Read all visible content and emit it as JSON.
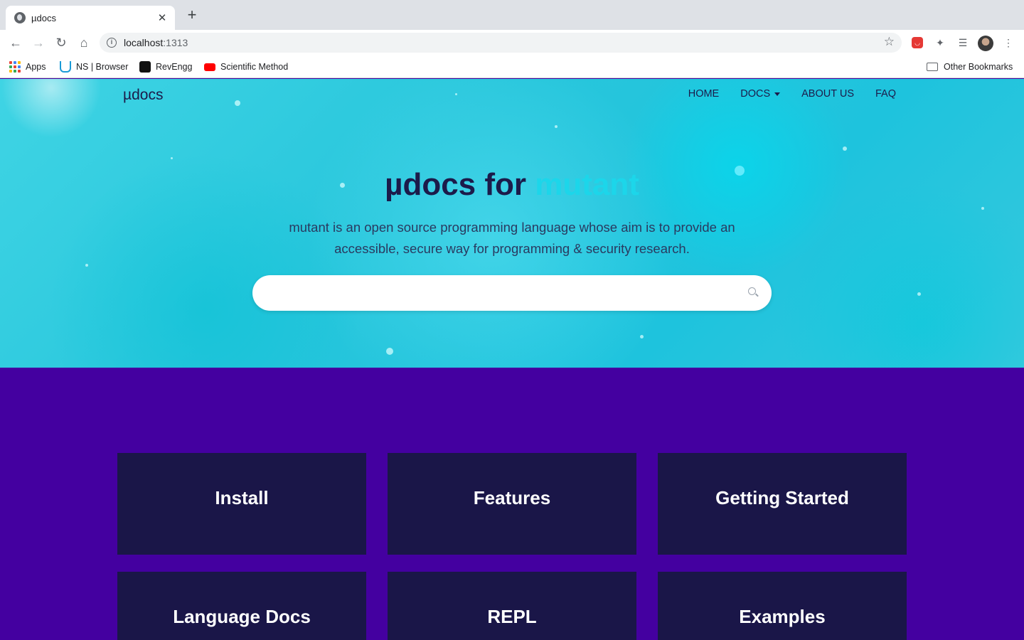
{
  "browser": {
    "tab_title": "µdocs",
    "tab_close": "✕",
    "new_tab": "+",
    "url_host": "localhost",
    "url_port": ":1313",
    "bookmarks": [
      {
        "label": "Apps"
      },
      {
        "label": "NS | Browser"
      },
      {
        "label": "RevEngg"
      },
      {
        "label": "Scientific Method"
      }
    ],
    "other_bookmarks": "Other Bookmarks"
  },
  "site": {
    "brand": "µdocs",
    "nav": [
      {
        "label": "HOME"
      },
      {
        "label": "DOCS"
      },
      {
        "label": "ABOUT US"
      },
      {
        "label": "FAQ"
      }
    ],
    "hero": {
      "title_main": "µdocs for ",
      "title_accent": "mutant",
      "subtitle": "mutant is an open source programming language whose aim is to provide an accessible, secure way for programming & security research.",
      "search_value": "",
      "search_placeholder": ""
    },
    "cards": [
      {
        "label": "Install"
      },
      {
        "label": "Features"
      },
      {
        "label": "Getting Started"
      },
      {
        "label": "Language Docs"
      },
      {
        "label": "REPL"
      },
      {
        "label": "Examples"
      }
    ]
  },
  "colors": {
    "hero_bg": "#28c6dc",
    "page_bg": "#4400a0",
    "card_bg": "#1a1648",
    "title_text": "#1c1b4a",
    "accent": "#1cd6ea"
  }
}
